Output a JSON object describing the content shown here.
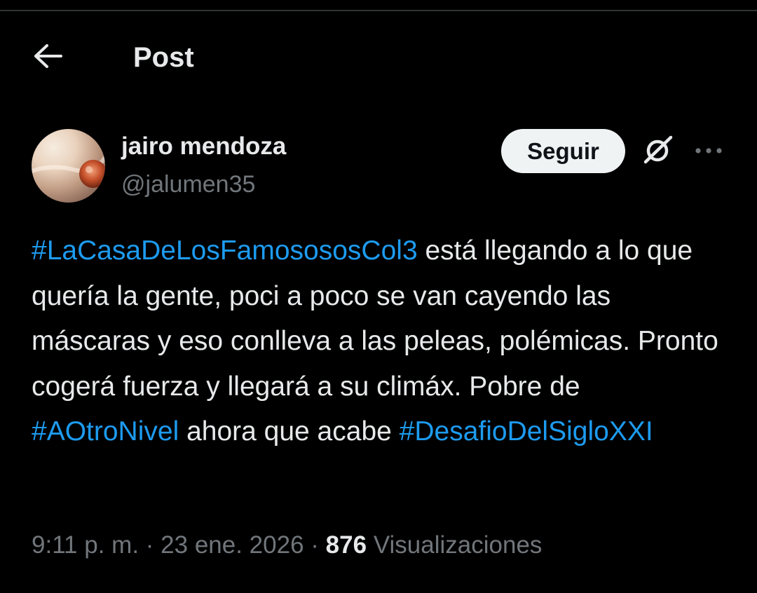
{
  "header": {
    "back_icon": "arrow-left-icon",
    "title": "Post"
  },
  "author": {
    "display_name": "jairo mendoza",
    "handle": "@jalumen35"
  },
  "actions": {
    "follow_label": "Seguir",
    "grok_icon": "grok-icon",
    "more_icon": "more-horizontal-icon"
  },
  "post": {
    "segments": [
      {
        "text": "#LaCasaDeLosFamosososCol3",
        "hashtag": true
      },
      {
        "text": " está llegando a lo que quería la gente, poci a poco se van cayendo las máscaras y eso conlleva a las peleas, polémicas. Pronto cogerá fuerza y llegará a su climáx. Pobre de ",
        "hashtag": false
      },
      {
        "text": "#AOtroNivel",
        "hashtag": true
      },
      {
        "text": " ahora que acabe ",
        "hashtag": false
      },
      {
        "text": "#DesafioDelSigloXXI",
        "hashtag": true
      }
    ]
  },
  "meta": {
    "time": "9:11 p. m.",
    "separator": "·",
    "date": "23 ene. 2026",
    "views_count": "876",
    "views_label": "Visualizaciones"
  },
  "colors": {
    "background": "#000000",
    "text": "#e7e9ea",
    "muted": "#71767b",
    "link": "#1d9bf0",
    "button_bg": "#eff3f4",
    "button_text": "#0f1419"
  }
}
